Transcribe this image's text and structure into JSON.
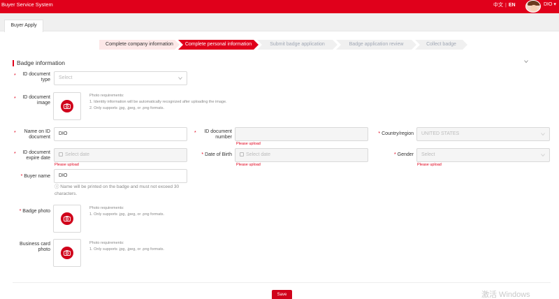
{
  "app_title": "Buyer Service System",
  "lang": {
    "zh": "中文",
    "en": "EN"
  },
  "user": {
    "name": "DIO"
  },
  "tabs": [
    {
      "label": "Buyer Apply"
    }
  ],
  "steps": [
    {
      "label": "Complete company information",
      "state": "done"
    },
    {
      "label": "Complete personal information",
      "state": "active"
    },
    {
      "label": "Submit badge application",
      "state": "pending"
    },
    {
      "label": "Badge application review",
      "state": "pending"
    },
    {
      "label": "Collect badge",
      "state": "pending"
    }
  ],
  "section_title": "Badge information",
  "form": {
    "id_doc_type": {
      "label": "ID document type",
      "placeholder": "Select"
    },
    "id_doc_image": {
      "label": "ID document image",
      "hint_title": "Photo requirements:",
      "hint_1": "1. Identity information will be automatically recognized after uploading the image.",
      "hint_2": "2. Only supports .jpg, .jpeg, or .png formats."
    },
    "name_on_id": {
      "label": "Name on ID document",
      "value": "DIO"
    },
    "id_doc_number": {
      "label": "ID document number",
      "value": "",
      "error": "Please upload"
    },
    "country": {
      "label": "Country/region",
      "value": "UNITED STATES"
    },
    "id_expire": {
      "label": "ID document expire date",
      "placeholder": "Select date",
      "error": "Please upload"
    },
    "dob": {
      "label": "Date of Birth",
      "placeholder": "Select date",
      "error": "Please upload"
    },
    "gender": {
      "label": "Gender",
      "placeholder": "Select",
      "error": "Please upload"
    },
    "buyer_name": {
      "label": "Buyer name",
      "value": "DIO",
      "note_1": "ⓘ Name will be printed on the badge and must not exceed 30",
      "note_2": "characters."
    },
    "badge_photo": {
      "label": "Badge photo",
      "hint_title": "Photo requirements:",
      "hint_1": "1. Only supports .jpg, .jpeg, or .png formats."
    },
    "business_card": {
      "label": "Business card photo",
      "hint_title": "Photo requirements:",
      "hint_1": "1. Only supports .jpg, .jpeg, or .png formats."
    }
  },
  "save_label": "Save",
  "watermark": "激活 Windows",
  "colors": {
    "brand": "#e0001b",
    "error": "#e0001b",
    "step_done": "#fde8e8",
    "step_pending": "#f0f0f0"
  }
}
